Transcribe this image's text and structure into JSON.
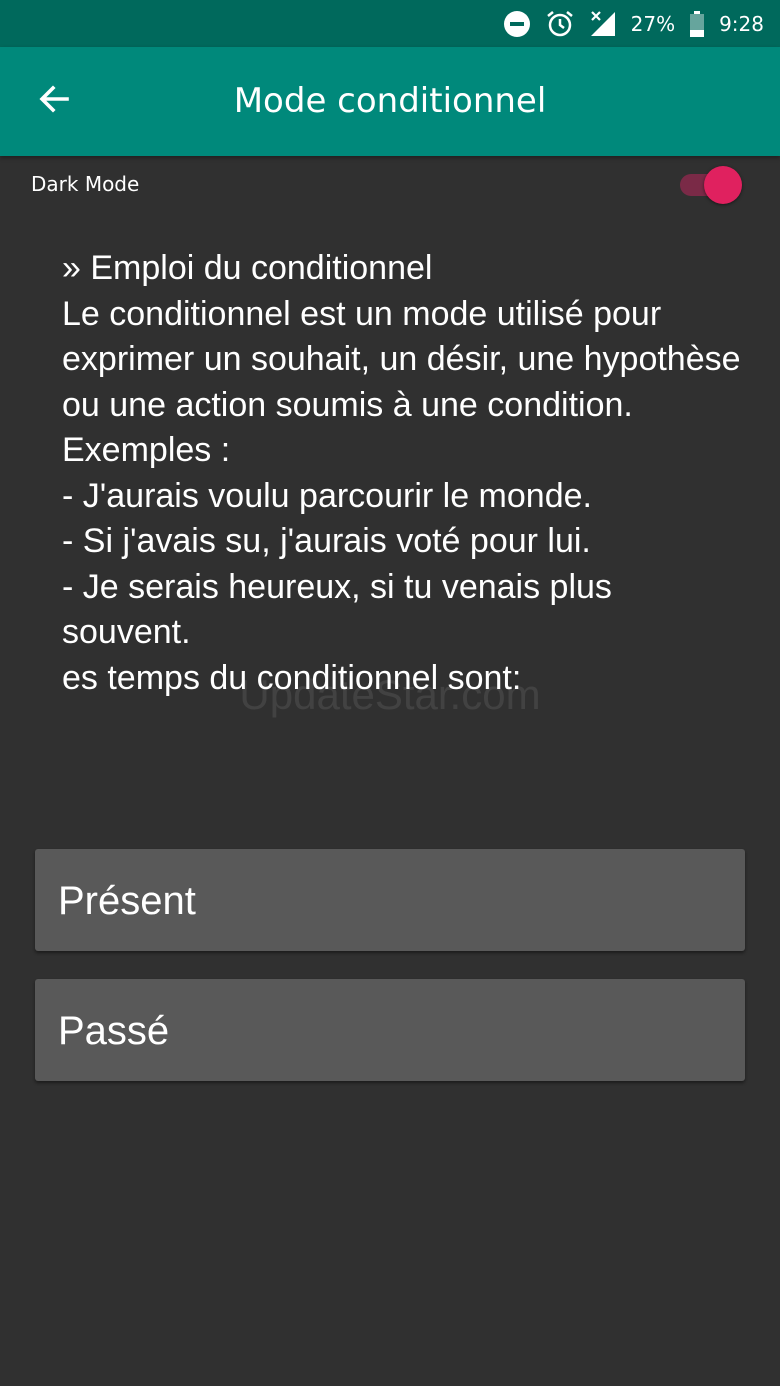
{
  "status_bar": {
    "battery_percent": "27%",
    "time": "9:28",
    "icons": [
      "do-not-disturb-icon",
      "alarm-icon",
      "no-signal-icon",
      "battery-icon"
    ]
  },
  "app_bar": {
    "title": "Mode conditionnel",
    "back_icon": "back-arrow-icon"
  },
  "dark_mode": {
    "label": "Dark Mode",
    "enabled": true
  },
  "content": {
    "text": "» Emploi du conditionnel\n Le conditionnel est un mode utilisé pour exprimer un souhait, un désir, une hypothèse ou une action soumis à une condition.\n Exemples :\n - J'aurais voulu parcourir le monde.\n - Si j'avais su, j'aurais voté pour lui.\n - Je serais heureux, si tu venais plus souvent.\n es temps du conditionnel sont:"
  },
  "watermark": "UpdateStar.com",
  "tense_buttons": [
    {
      "label": "Présent"
    },
    {
      "label": "Passé"
    }
  ],
  "colors": {
    "status_bar": "#00695c",
    "app_bar": "#00897b",
    "background": "#303030",
    "button": "#595959",
    "toggle_accent": "#e0215f"
  }
}
